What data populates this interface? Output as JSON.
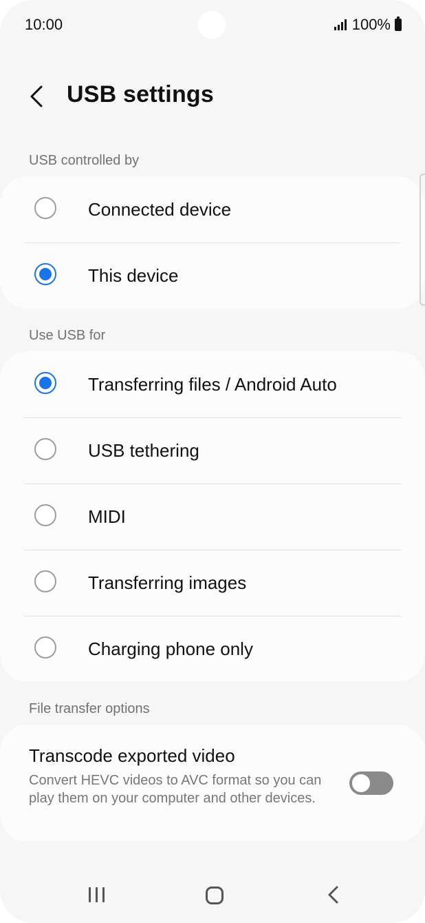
{
  "status_bar": {
    "time": "10:00",
    "battery": "100%"
  },
  "header": {
    "title": "USB settings"
  },
  "usb_controlled_by": {
    "label": "USB controlled by",
    "options": [
      {
        "label": "Connected device",
        "selected": false
      },
      {
        "label": "This device",
        "selected": true
      }
    ]
  },
  "use_usb_for": {
    "label": "Use USB for",
    "options": [
      {
        "label": "Transferring files / Android Auto",
        "selected": true
      },
      {
        "label": "USB tethering",
        "selected": false
      },
      {
        "label": "MIDI",
        "selected": false
      },
      {
        "label": "Transferring images",
        "selected": false
      },
      {
        "label": "Charging phone only",
        "selected": false
      }
    ]
  },
  "file_transfer_options": {
    "label": "File transfer options",
    "transcode": {
      "title": "Transcode exported video",
      "description": "Convert HEVC videos to AVC format so you can play them on your computer and other devices.",
      "enabled": false
    }
  },
  "colors": {
    "accent": "#1a73e8",
    "toggle_off": "#8a8a8a",
    "background": "#f6f6f6"
  },
  "icons": {
    "back": "chevron-left-icon",
    "nav_recent": "recent-apps-icon",
    "nav_home": "home-icon",
    "nav_back": "nav-back-icon",
    "signal": "signal-icon",
    "battery": "battery-icon"
  }
}
